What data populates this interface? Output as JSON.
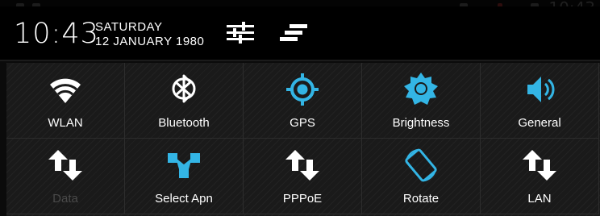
{
  "statusbar": {
    "time": "10:43"
  },
  "header": {
    "clock": "10:43",
    "day": "SATURDAY",
    "date": "12 JANUARY 1980",
    "settings_icon": "sliders-icon",
    "notifications_icon": "clear-notifications-icon"
  },
  "colors": {
    "accent": "#33b5e5",
    "text": "#ffffff",
    "disabled": "#4a4a4a",
    "background": "#1a1a1a"
  },
  "tiles": [
    {
      "label": "WLAN",
      "icon": "wifi-icon",
      "active": true
    },
    {
      "label": "Bluetooth",
      "icon": "bluetooth-icon",
      "active": false
    },
    {
      "label": "GPS",
      "icon": "gps-icon",
      "active": true
    },
    {
      "label": "Brightness",
      "icon": "brightness-icon",
      "active": true
    },
    {
      "label": "General",
      "icon": "volume-icon",
      "active": true
    },
    {
      "label": "Data",
      "icon": "data-transfer-icon",
      "active": false
    },
    {
      "label": "Select Apn",
      "icon": "network-icon",
      "active": true
    },
    {
      "label": "PPPoE",
      "icon": "transfer-icon",
      "active": true
    },
    {
      "label": "Rotate",
      "icon": "rotate-icon",
      "active": true
    },
    {
      "label": "LAN",
      "icon": "transfer-icon",
      "active": true
    }
  ]
}
